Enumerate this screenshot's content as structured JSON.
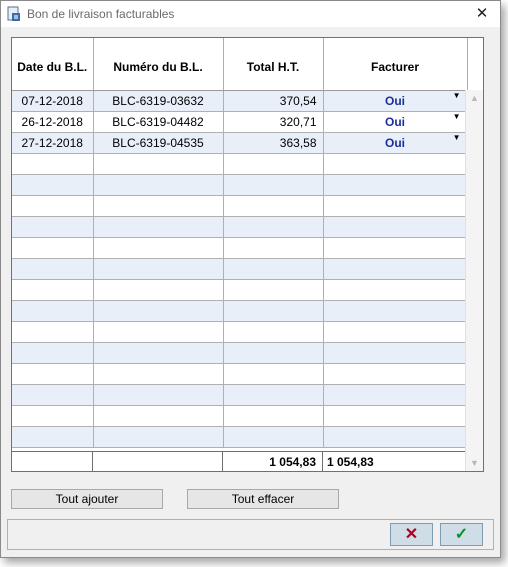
{
  "window": {
    "title": "Bon de livraison facturables"
  },
  "grid": {
    "columns": [
      "Date du B.L.",
      "Numéro du B.L.",
      "Total H.T.",
      "Facturer"
    ],
    "rows": [
      {
        "date": "07-12-2018",
        "numero": "BLC-6319-03632",
        "total": "370,54",
        "facturer": "Oui"
      },
      {
        "date": "26-12-2018",
        "numero": "BLC-6319-04482",
        "total": "320,71",
        "facturer": "Oui"
      },
      {
        "date": "27-12-2018",
        "numero": "BLC-6319-04535",
        "total": "363,58",
        "facturer": "Oui"
      }
    ],
    "totals": {
      "total_ht": "1 054,83",
      "facturer": "1 054,83"
    }
  },
  "buttons": {
    "add_all": "Tout ajouter",
    "clear_all": "Tout effacer",
    "cancel_glyph": "✕",
    "ok_glyph": "✓"
  },
  "colors": {
    "alt_row": "#e9eff9",
    "oui_text": "#1a2f9b",
    "cancel": "#b00020",
    "ok": "#0a8f2a"
  }
}
